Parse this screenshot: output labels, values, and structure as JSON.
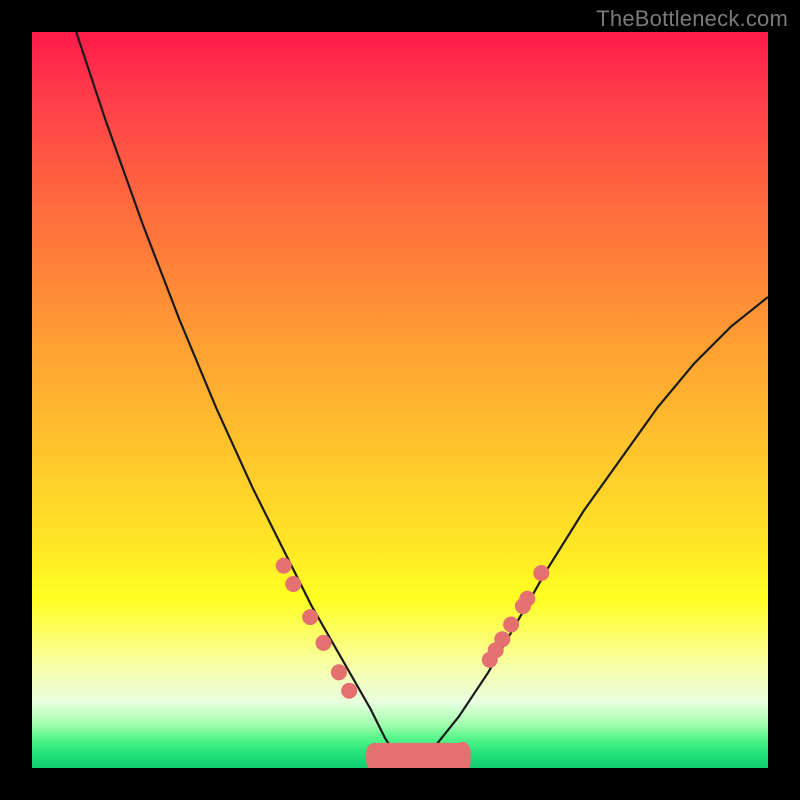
{
  "watermark": "TheBottleneck.com",
  "chart_data": {
    "type": "line",
    "title": "",
    "xlabel": "",
    "ylabel": "",
    "xlim": [
      0,
      100
    ],
    "ylim": [
      0,
      100
    ],
    "grid": false,
    "legend": false,
    "note": "Axes are unlabeled; values are pixel-normalized estimates of the plotted curve and marker positions.",
    "series": [
      {
        "name": "bottleneck-curve",
        "kind": "line",
        "x": [
          6,
          10,
          15,
          20,
          25,
          30,
          34,
          38,
          42,
          46,
          48,
          50,
          52,
          54,
          58,
          62,
          66,
          70,
          75,
          80,
          85,
          90,
          95,
          100
        ],
        "y": [
          100,
          88,
          74,
          61,
          49,
          38,
          30,
          22,
          15,
          8,
          4,
          1,
          0,
          2,
          7,
          13,
          20,
          27,
          35,
          42,
          49,
          55,
          60,
          64
        ]
      },
      {
        "name": "left-branch-markers",
        "kind": "scatter",
        "x": [
          34.2,
          35.5,
          37.8,
          39.6,
          41.7,
          43.1
        ],
        "y": [
          27.5,
          25,
          20.5,
          17,
          13,
          10.5
        ]
      },
      {
        "name": "right-branch-markers",
        "kind": "scatter",
        "x": [
          62.2,
          63.0,
          63.9,
          65.1,
          66.7,
          67.3,
          69.2
        ],
        "y": [
          14.7,
          16.0,
          17.5,
          19.5,
          22.0,
          23.0,
          26.5
        ]
      },
      {
        "name": "trough-markers",
        "kind": "scatter",
        "x": [
          46.5,
          48.0,
          50.0,
          52.0,
          54.0,
          56.5,
          58.5
        ],
        "y": [
          1.2,
          0.8,
          0.6,
          0.6,
          0.8,
          1.4,
          2.6
        ]
      }
    ]
  }
}
